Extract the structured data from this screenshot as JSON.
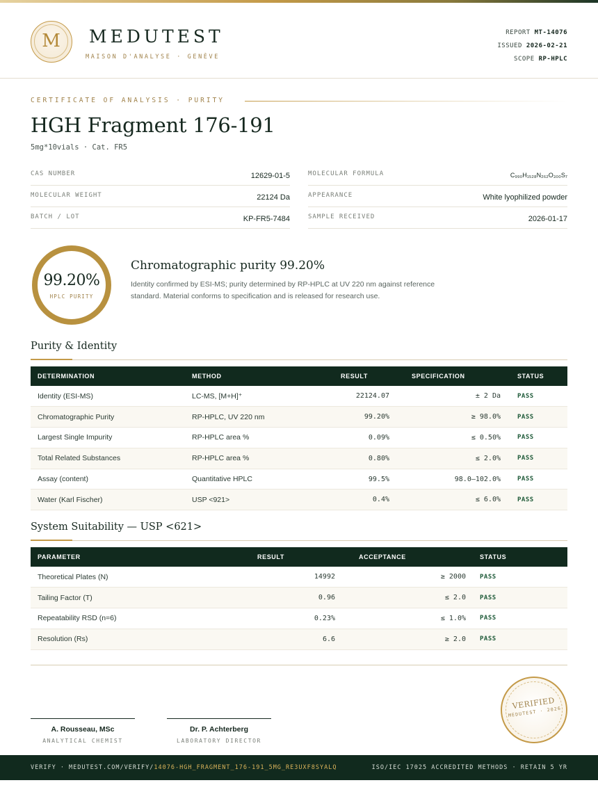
{
  "brand": {
    "logo_letter": "M",
    "name": "MEDUTEST",
    "tagline": "MAISON D'ANALYSE · GENÈVE"
  },
  "meta": {
    "report_label": "REPORT",
    "report_value": "MT-14076",
    "issued_label": "ISSUED",
    "issued_value": "2026-02-21",
    "scope_label": "SCOPE",
    "scope_value": "RP-HPLC"
  },
  "document": {
    "eyebrow": "CERTIFICATE OF ANALYSIS · PURITY",
    "title": "HGH Fragment 176-191",
    "subtitle": "5mg*10vials  ·  Cat. FR5"
  },
  "properties": {
    "cas_label": "CAS NUMBER",
    "cas_value": "12629-01-5",
    "mw_label": "MOLECULAR WEIGHT",
    "mw_value": "22124 Da",
    "batch_label": "BATCH / LOT",
    "batch_value": "KP-FR5-7484",
    "formula_label": "MOLECULAR FORMULA",
    "formula_value": "C₉₉₀H₁₅₂₈N₂₆₂O₃₀₀S₇",
    "appearance_label": "APPEARANCE",
    "appearance_value": "White lyophilized powder",
    "received_label": "SAMPLE RECEIVED",
    "received_value": "2026-01-17"
  },
  "purity": {
    "ring_value": "99.20%",
    "ring_label": "HPLC PURITY",
    "headline": "Chromatographic purity 99.20%",
    "description": "Identity confirmed by ESI-MS; purity determined by RP-HPLC at UV 220 nm against reference standard. Material conforms to specification and is released for research use."
  },
  "identity_section": {
    "title": "Purity & Identity",
    "headers": [
      "DETERMINATION",
      "METHOD",
      "RESULT",
      "SPECIFICATION",
      "STATUS"
    ],
    "rows": [
      [
        "Identity (ESI-MS)",
        "LC-MS, [M+H]⁺",
        "22124.07",
        "± 2 Da",
        "PASS"
      ],
      [
        "Chromatographic Purity",
        "RP-HPLC, UV 220 nm",
        "99.20%",
        "≥ 98.0%",
        "PASS"
      ],
      [
        "Largest Single Impurity",
        "RP-HPLC area %",
        "0.09%",
        "≤ 0.50%",
        "PASS"
      ],
      [
        "Total Related Substances",
        "RP-HPLC area %",
        "0.80%",
        "≤ 2.0%",
        "PASS"
      ],
      [
        "Assay (content)",
        "Quantitative HPLC",
        "99.5%",
        "98.0–102.0%",
        "PASS"
      ],
      [
        "Water (Karl Fischer)",
        "USP <921>",
        "0.4%",
        "≤ 6.0%",
        "PASS"
      ]
    ]
  },
  "suitability_section": {
    "title": "System Suitability — USP <621>",
    "headers": [
      "PARAMETER",
      "RESULT",
      "ACCEPTANCE",
      "STATUS"
    ],
    "rows": [
      [
        "Theoretical Plates (N)",
        "14992",
        "≥ 2000",
        "PASS"
      ],
      [
        "Tailing Factor (T)",
        "0.96",
        "≤ 2.0",
        "PASS"
      ],
      [
        "Repeatability RSD (n=6)",
        "0.23%",
        "≤ 1.0%",
        "PASS"
      ],
      [
        "Resolution (Rs)",
        "6.6",
        "≥ 2.0",
        "PASS"
      ]
    ]
  },
  "signatures": [
    {
      "name": "A. Rousseau, MSc",
      "role": "ANALYTICAL CHEMIST"
    },
    {
      "name": "Dr. P. Achterberg",
      "role": "LABORATORY DIRECTOR"
    }
  ],
  "seal": {
    "main": "VERIFIED",
    "sub": "MEDUTEST · 2026"
  },
  "footer": {
    "verify_prefix": "VERIFY · MEDUTEST.COM/VERIFY/",
    "verify_code": "14076-HGH_FRAGMENT_176-191_5MG_RE3UXF8SYALQ",
    "right": "ISO/IEC 17025 ACCREDITED METHODS · RETAIN 5 YR"
  }
}
